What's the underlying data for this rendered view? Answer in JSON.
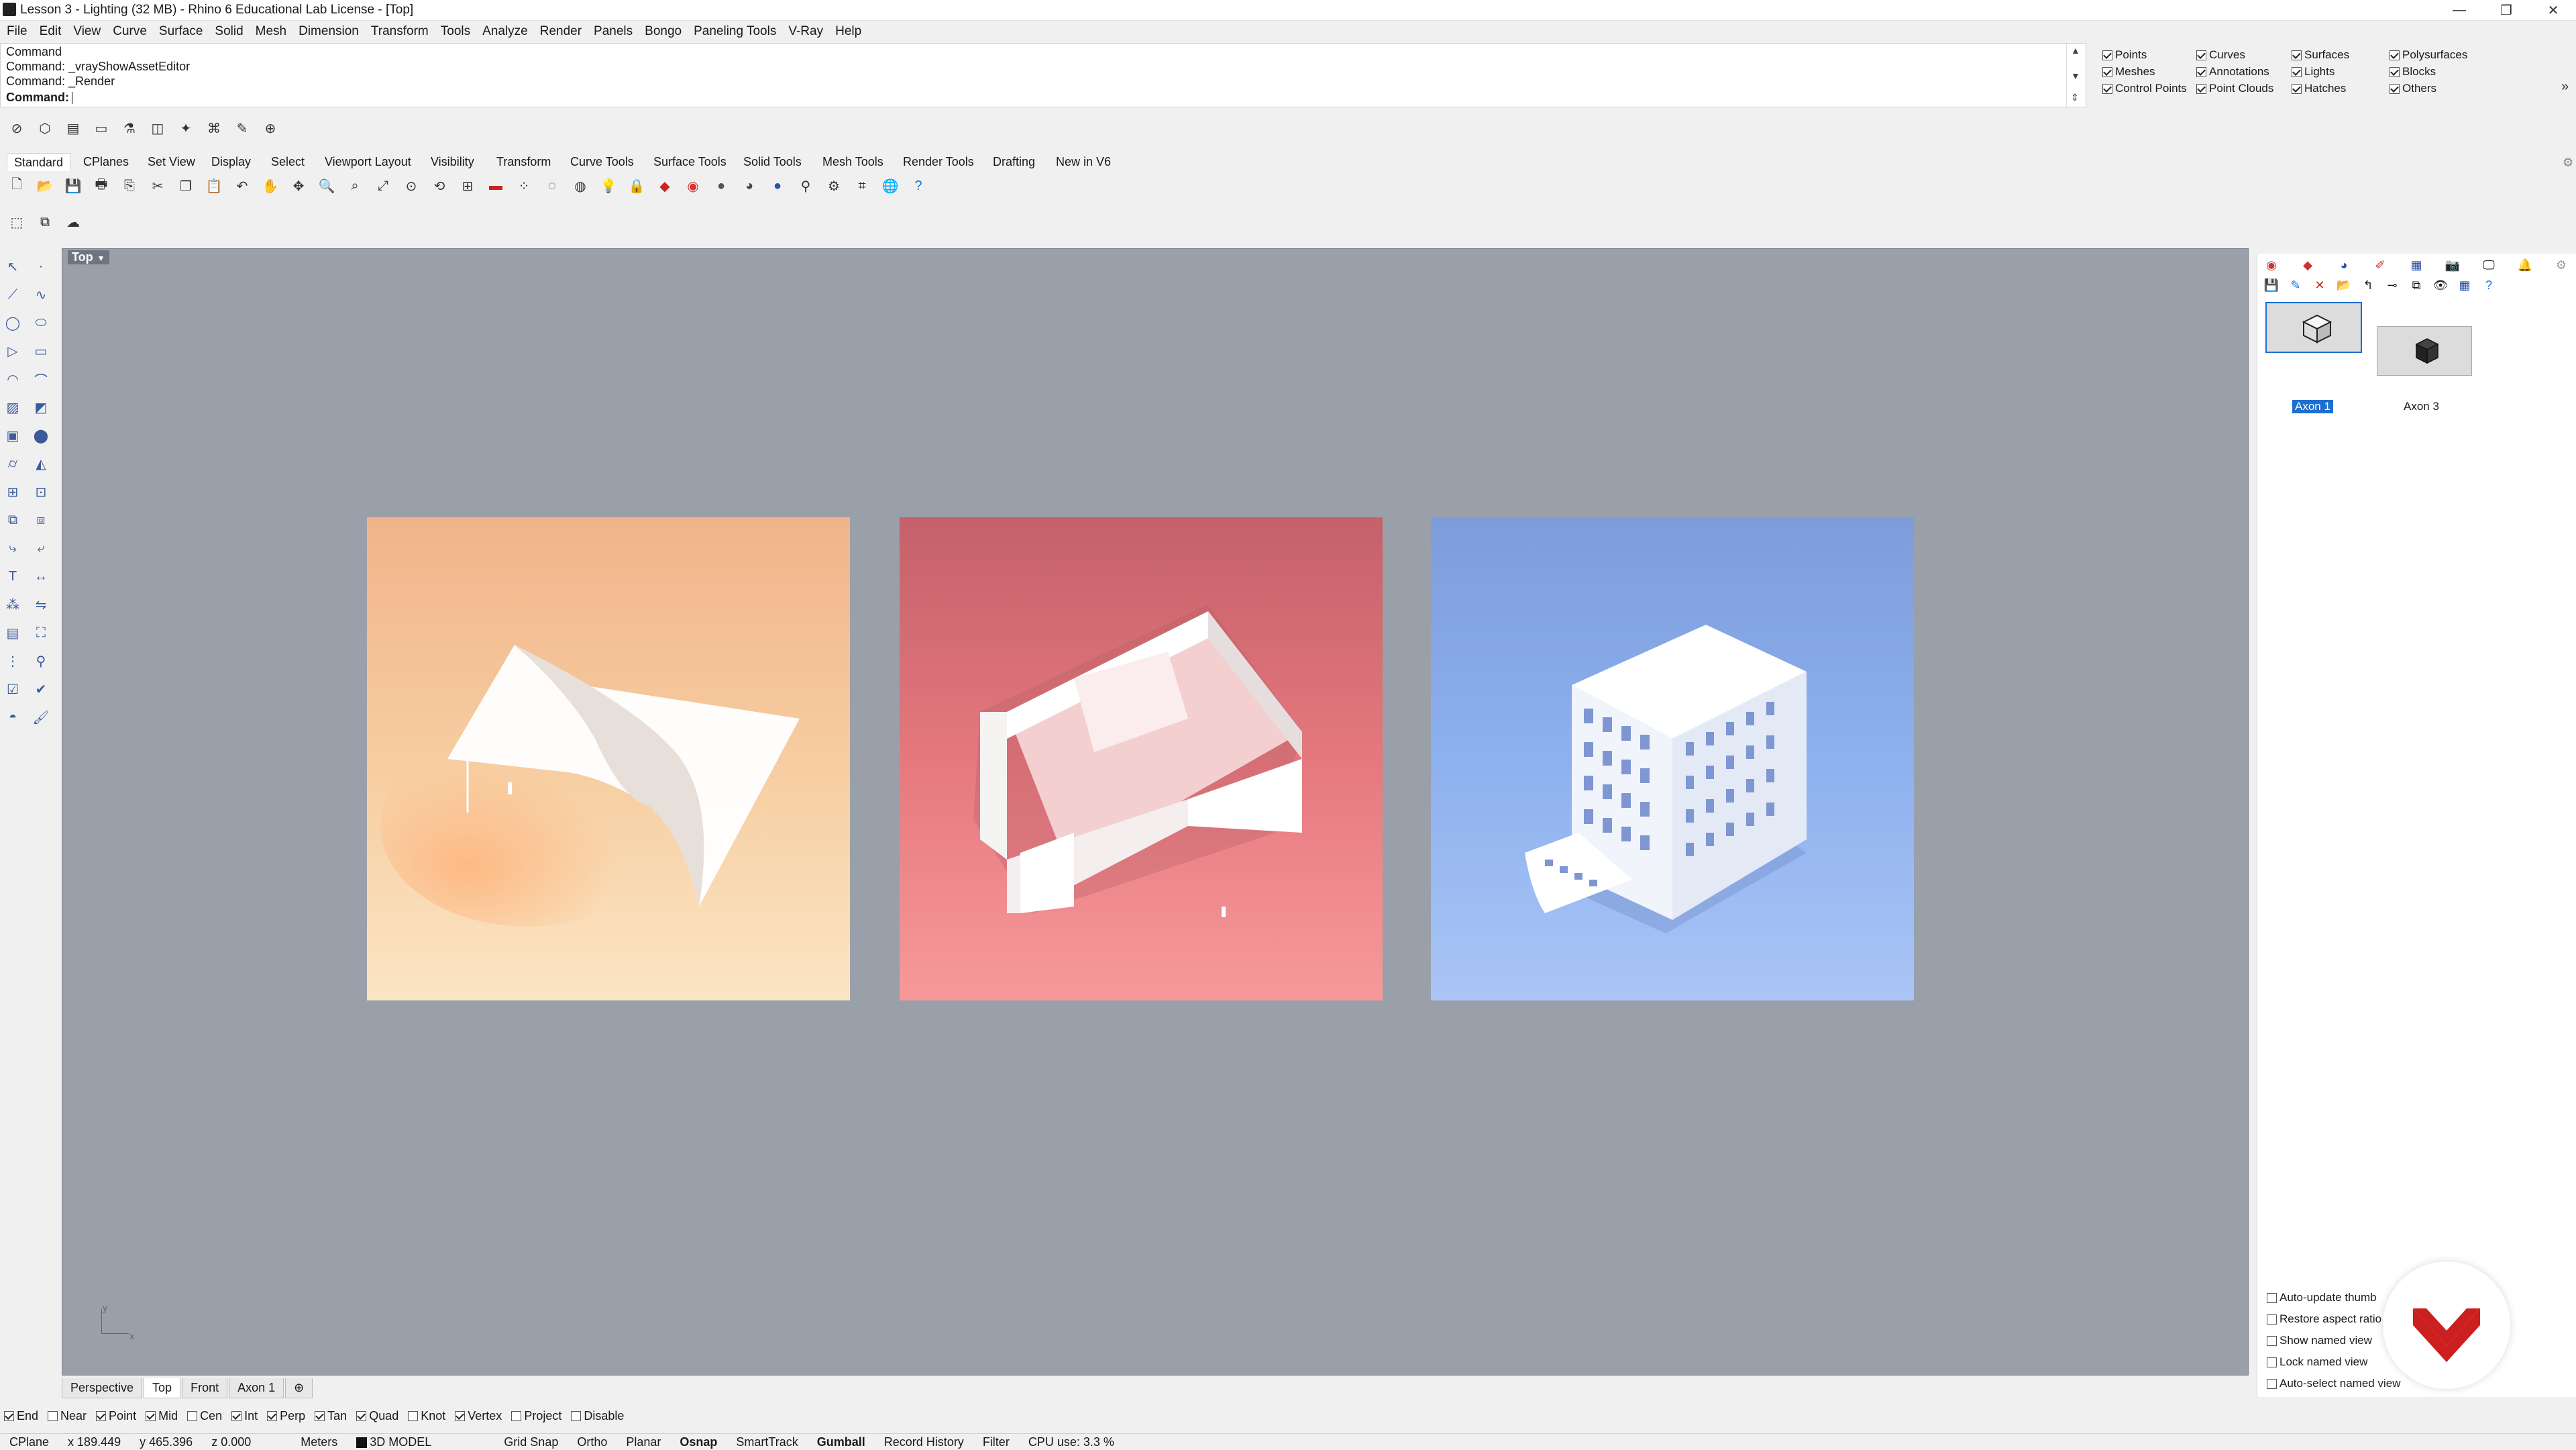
{
  "window": {
    "title": "Lesson 3 - Lighting (32 MB) - Rhino 6 Educational Lab License - [Top]",
    "minimize": "—",
    "restore": "❐",
    "close": "✕"
  },
  "menu": [
    "File",
    "Edit",
    "View",
    "Curve",
    "Surface",
    "Solid",
    "Mesh",
    "Dimension",
    "Transform",
    "Tools",
    "Analyze",
    "Render",
    "Panels",
    "Bongo",
    "Paneling Tools",
    "V-Ray",
    "Help"
  ],
  "command": {
    "history": [
      "Command",
      "Command: _vrayShowAssetEditor",
      "Command: _Render"
    ],
    "prompt": "Command:"
  },
  "filter": [
    {
      "label": "Points",
      "checked": true
    },
    {
      "label": "Curves",
      "checked": true
    },
    {
      "label": "Surfaces",
      "checked": true
    },
    {
      "label": "Polysurfaces",
      "checked": true
    },
    {
      "label": "Meshes",
      "checked": true
    },
    {
      "label": "Annotations",
      "checked": true
    },
    {
      "label": "Lights",
      "checked": true
    },
    {
      "label": "Blocks",
      "checked": true
    },
    {
      "label": "Control Points",
      "checked": true
    },
    {
      "label": "Point Clouds",
      "checked": true
    },
    {
      "label": "Hatches",
      "checked": true
    },
    {
      "label": "Others",
      "checked": true
    }
  ],
  "tabs": [
    "Standard",
    "CPlanes",
    "Set View",
    "Display",
    "Select",
    "Viewport Layout",
    "Visibility",
    "Transform",
    "Curve Tools",
    "Surface Tools",
    "Solid Tools",
    "Mesh Tools",
    "Render Tools",
    "Drafting",
    "New in V6"
  ],
  "viewport": {
    "label": "Top",
    "axis_x": "x",
    "axis_y": "y",
    "renders": [
      {
        "name": "orange-pavilion",
        "bg_top": "#f3b98e",
        "bg_bottom": "#fbe3bd"
      },
      {
        "name": "red-walls",
        "bg_top": "#c9666a",
        "bg_bottom": "#f48c8e"
      },
      {
        "name": "blue-building",
        "bg_top": "#7b9ad8",
        "bg_bottom": "#a9c2f3"
      }
    ]
  },
  "viewport_tabs": [
    "Perspective",
    "Top",
    "Front",
    "Axon 1"
  ],
  "osnaps": [
    {
      "label": "End",
      "checked": true
    },
    {
      "label": "Near",
      "checked": false
    },
    {
      "label": "Point",
      "checked": true
    },
    {
      "label": "Mid",
      "checked": true
    },
    {
      "label": "Cen",
      "checked": false
    },
    {
      "label": "Int",
      "checked": true
    },
    {
      "label": "Perp",
      "checked": true
    },
    {
      "label": "Tan",
      "checked": true
    },
    {
      "label": "Quad",
      "checked": true
    },
    {
      "label": "Knot",
      "checked": false
    },
    {
      "label": "Vertex",
      "checked": true
    },
    {
      "label": "Project",
      "checked": false
    },
    {
      "label": "Disable",
      "checked": false
    }
  ],
  "status": {
    "cplane": "CPlane",
    "x": "x 189.449",
    "y": "y 465.396",
    "z": "z 0.000",
    "units": "Meters",
    "layer": "3D MODEL",
    "toggles": [
      "Grid Snap",
      "Ortho",
      "Planar",
      "Osnap",
      "SmartTrack",
      "Gumball",
      "Record History",
      "Filter"
    ],
    "active_toggles": [
      "Osnap",
      "Gumball"
    ],
    "cpu": "CPU use: 3.3 %"
  },
  "named_views": {
    "thumbs": [
      "Axon 1",
      "Axon 3"
    ],
    "selected": "Axon 1",
    "options": [
      {
        "label": "Auto-update thumb",
        "checked": false
      },
      {
        "label": "Restore aspect ratio",
        "checked": false
      },
      {
        "label": "Show named view",
        "checked": false
      },
      {
        "label": "Lock named view",
        "checked": false
      },
      {
        "label": "Auto-select named view",
        "checked": false
      }
    ]
  },
  "colors": {
    "accent": "#1e6fd0",
    "logo": "#cc1f1f",
    "viewport_bg": "#9aa0a9"
  }
}
